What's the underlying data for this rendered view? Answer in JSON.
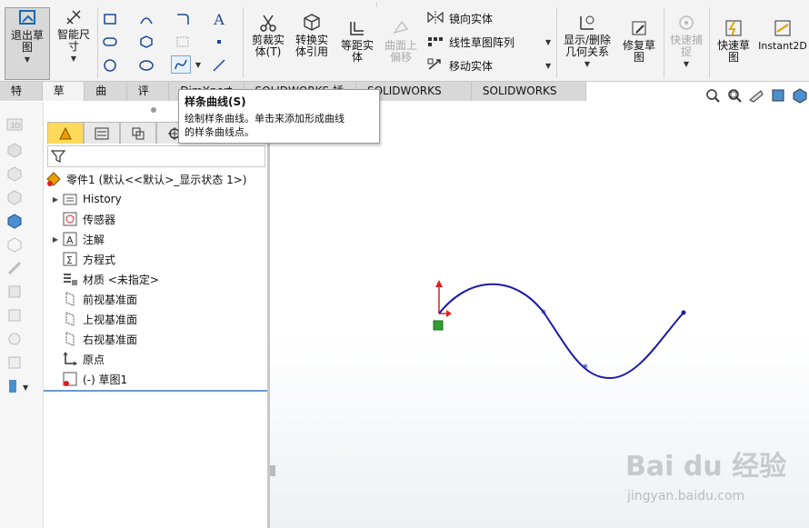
{
  "ribbon": {
    "exit_sketch": "退出草图",
    "smart_dim": "智能尺寸",
    "trim": "剪裁实体(T)",
    "convert": "转换实体引用",
    "offset": "等距实体",
    "surface_offset": "曲面上偏移",
    "mirror": "镜向实体",
    "linear_pattern": "线性草图阵列",
    "move": "移动实体",
    "show_delete": "显示/删除几何关系",
    "repair": "修复草图",
    "quick_snap": "快速捕捉",
    "rapid_sketch": "快速草图",
    "instant2d": "Instant2D"
  },
  "tabs": [
    "特征",
    "草图",
    "曲面",
    "评估",
    "DimXpert",
    "SOLIDWORKS 插件",
    "SOLIDWORKS MBD",
    "SOLIDWORKS CAM"
  ],
  "tooltip": {
    "title": "样条曲线(S)",
    "line1": "绘制样条曲线。单击来添加形成曲线",
    "line2": "的样条曲线点。"
  },
  "tree": {
    "root": "零件1  (默认<<默认>_显示状态 1>)",
    "items": [
      "History",
      "传感器",
      "注解",
      "方程式",
      "材质 <未指定>",
      "前视基准面",
      "上视基准面",
      "右视基准面",
      "原点",
      "(-) 草图1"
    ]
  },
  "watermark": {
    "logo": "Bai du 经验",
    "url": "jingyan.baidu.com"
  },
  "colors": {
    "spline": "#1a1aa8",
    "accent": "#ffd95a",
    "axis_red": "#e02020",
    "origin_green": "#30a030"
  }
}
